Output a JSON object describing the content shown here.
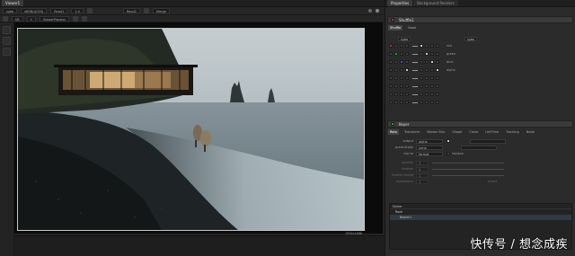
{
  "viewer": {
    "tab_label": "Viewer1",
    "toolbar": {
      "channels": "rgba",
      "colorspace": "sRGB(ACES)",
      "a_input": "Read1",
      "zoom": "1.0",
      "wipe_input": "Read1",
      "gain": "f/8",
      "y_label": "Y",
      "input_a": "Read2",
      "input_b": "Merge"
    },
    "frame_tab": "ViewerProcess",
    "resolution_label": "1920x1080"
  },
  "properties": {
    "tab_labels": [
      "Properties",
      "Background Renders"
    ],
    "node_shuffle": {
      "name": "Shuffle1",
      "sub_tabs": [
        "Shuffle",
        "Node"
      ],
      "input_label": "rgba",
      "out_label": "rgba",
      "channel_labels": [
        "red",
        "green",
        "blue",
        "alpha"
      ],
      "aux_labels": [
        "rgba",
        "rgba"
      ]
    },
    "node_keyer": {
      "name": "Keyer",
      "sub_tabs": [
        "Roto",
        "Transform",
        "Motion Blur",
        "Shape",
        "Clone",
        "LifeTime",
        "Tracking",
        "Node"
      ],
      "rows": [
        {
          "label": "output",
          "value": "alpha"
        },
        {
          "label": "premultiply",
          "value": "none"
        },
        {
          "label": "clip to",
          "value": "format"
        },
        {
          "label": "opacity",
          "value": "1"
        },
        {
          "label": "feather",
          "value": "0"
        },
        {
          "label": "feather falloff",
          "value": "1"
        },
        {
          "label": "motionblur",
          "value": "1"
        }
      ],
      "flags": [
        "replace",
        "invert",
        "feather"
      ],
      "tree_header": "Name",
      "tree_items": [
        "Root",
        "Bezier1"
      ]
    }
  },
  "watermark": "快传号 / 想念成疾",
  "colors": {
    "accent_red": "#b03030",
    "accent_green": "#2f9c3a",
    "accent_blue": "#2c54b8",
    "panel_bg": "#2b2b2b"
  }
}
